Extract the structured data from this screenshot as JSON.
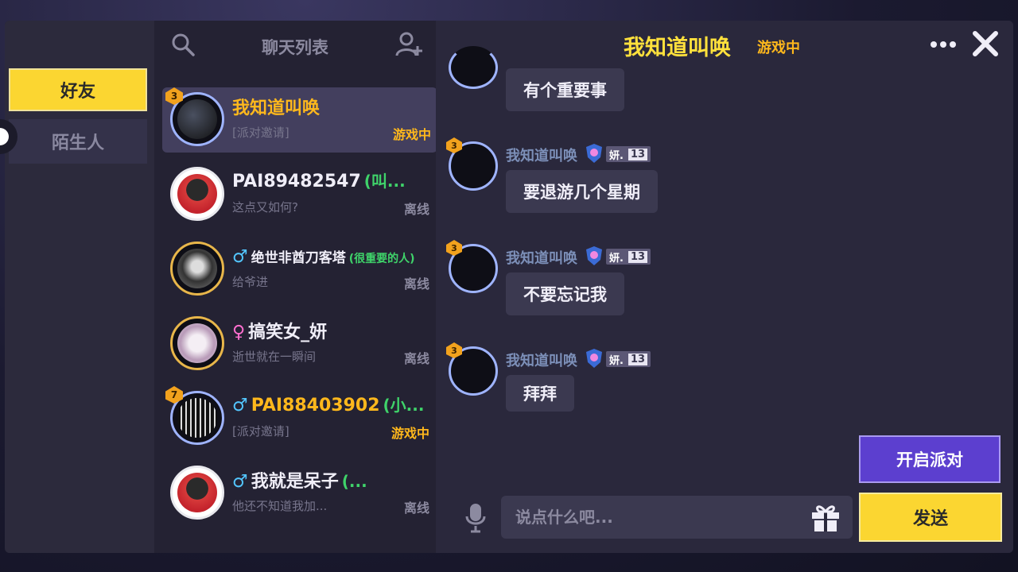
{
  "categories": {
    "friends": "好友",
    "strangers": "陌生人"
  },
  "list": {
    "title": "聊天列表",
    "friends": [
      {
        "name": "我知道叫唤",
        "remark": "",
        "gender": "",
        "message": "[派对邀请]",
        "status": "游戏中",
        "level": "3",
        "selected": true
      },
      {
        "name": "PAI89482547",
        "remark": "(叫...",
        "gender": "",
        "message": "这点又如何?",
        "status": "离线",
        "level": "",
        "selected": false
      },
      {
        "name": "绝世非酋刀客塔",
        "remark": "(很重要的人)",
        "gender": "♂",
        "message": "给爷进",
        "status": "离线",
        "level": "",
        "selected": false
      },
      {
        "name": "搞笑女_妍",
        "remark": "",
        "gender": "♀",
        "message": "逝世就在一瞬间",
        "status": "离线",
        "level": "",
        "selected": false
      },
      {
        "name": "PAI88403902",
        "remark": "(小...",
        "gender": "♂",
        "message": "[派对邀请]",
        "status": "游戏中",
        "level": "7",
        "selected": false
      },
      {
        "name": "我就是呆子",
        "remark": "(...",
        "gender": "♂",
        "message": "他还不知道我加...",
        "status": "离线",
        "level": "",
        "selected": false
      }
    ]
  },
  "chat": {
    "title": "我知道叫唤",
    "title_status": "游戏中",
    "messages": [
      {
        "sender": "",
        "tag": "",
        "tag_num": "",
        "text": "有个重要事"
      },
      {
        "sender": "我知道叫唤",
        "tag": "妍.",
        "tag_num": "13",
        "text": "要退游几个星期"
      },
      {
        "sender": "我知道叫唤",
        "tag": "妍.",
        "tag_num": "13",
        "text": "不要忘记我"
      },
      {
        "sender": "我知道叫唤",
        "tag": "妍.",
        "tag_num": "13",
        "text": "拜拜"
      }
    ],
    "sender_level": "3",
    "input_placeholder": "说点什么吧...",
    "party_button": "开启派对",
    "send_button": "发送"
  },
  "colors": {
    "accent_yellow": "#fbd631",
    "party_purple": "#5c3fcf",
    "in_game_orange": "#ffb81c",
    "remark_green": "#3fd36a"
  }
}
